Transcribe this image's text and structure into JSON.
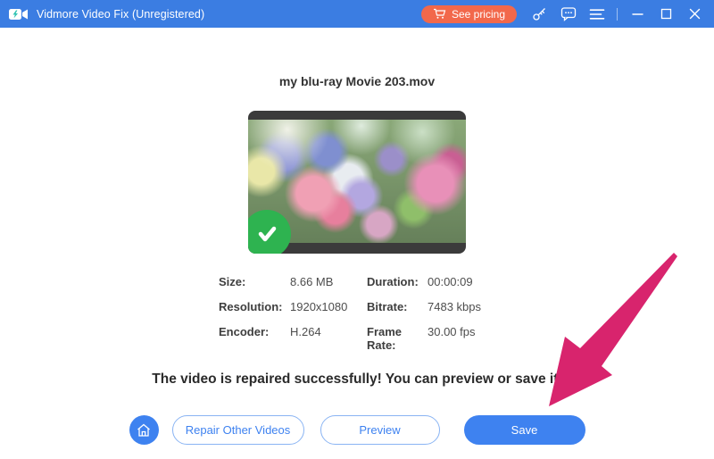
{
  "titlebar": {
    "title": "Vidmore Video Fix (Unregistered)",
    "see_pricing_label": "See pricing"
  },
  "main": {
    "filename": "my blu-ray Movie 203.mov",
    "metadata": [
      {
        "label": "Size:",
        "value": "8.66 MB"
      },
      {
        "label": "Duration:",
        "value": "00:00:09"
      },
      {
        "label": "Resolution:",
        "value": "1920x1080"
      },
      {
        "label": "Bitrate:",
        "value": "7483 kbps"
      },
      {
        "label": "Encoder:",
        "value": "H.264"
      },
      {
        "label": "Frame Rate:",
        "value": "30.00 fps"
      }
    ],
    "message": "The video is repaired successfully! You can preview or save it.",
    "buttons": {
      "repair": "Repair Other Videos",
      "preview": "Preview",
      "save": "Save"
    }
  },
  "icons": {
    "app": "camcorder-icon",
    "pricing": "cart-icon",
    "register": "key-icon",
    "feedback": "chat-bubble-icon",
    "menu": "hamburger-icon",
    "minimize": "minimize-icon",
    "maximize": "maximize-icon",
    "close": "close-icon",
    "home": "home-icon",
    "status": "check-icon",
    "annotation": "pink-arrow"
  },
  "colors": {
    "titlebar_blue": "#3b7de2",
    "accent_blue": "#3e82f0",
    "pricing_orange": "#f2684b",
    "success_green": "#2eb350",
    "arrow_pink": "#d8246d"
  }
}
